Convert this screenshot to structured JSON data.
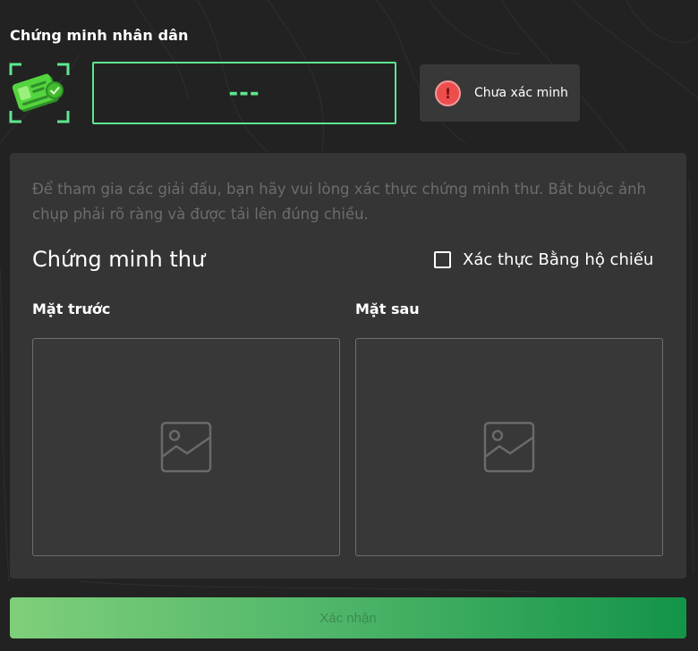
{
  "section": {
    "title": "Chứng minh nhân dân"
  },
  "id_number": {
    "value": "---"
  },
  "status": {
    "icon_symbol": "!",
    "label": "Chưa xác minh",
    "icon": "alert-circle-icon",
    "color": "#ee4d4d"
  },
  "card": {
    "description": "Để tham gia các giải đấu, bạn hãy vui lòng xác thực chứng minh thư. Bắt buộc ảnh chụp phải rõ ràng và được tải lên đúng chiều.",
    "heading": "Chứng minh thư",
    "passport_label": "Xác thực Bằng hộ chiếu",
    "passport_checked": false,
    "front_label": "Mặt trước",
    "back_label": "Mặt sau",
    "upload_icon": "image-placeholder-icon"
  },
  "actions": {
    "confirm_label": "Xác nhận"
  },
  "colors": {
    "accent": "#5ee690",
    "background": "#222222",
    "card": "#353535",
    "error": "#ee4d4d"
  }
}
